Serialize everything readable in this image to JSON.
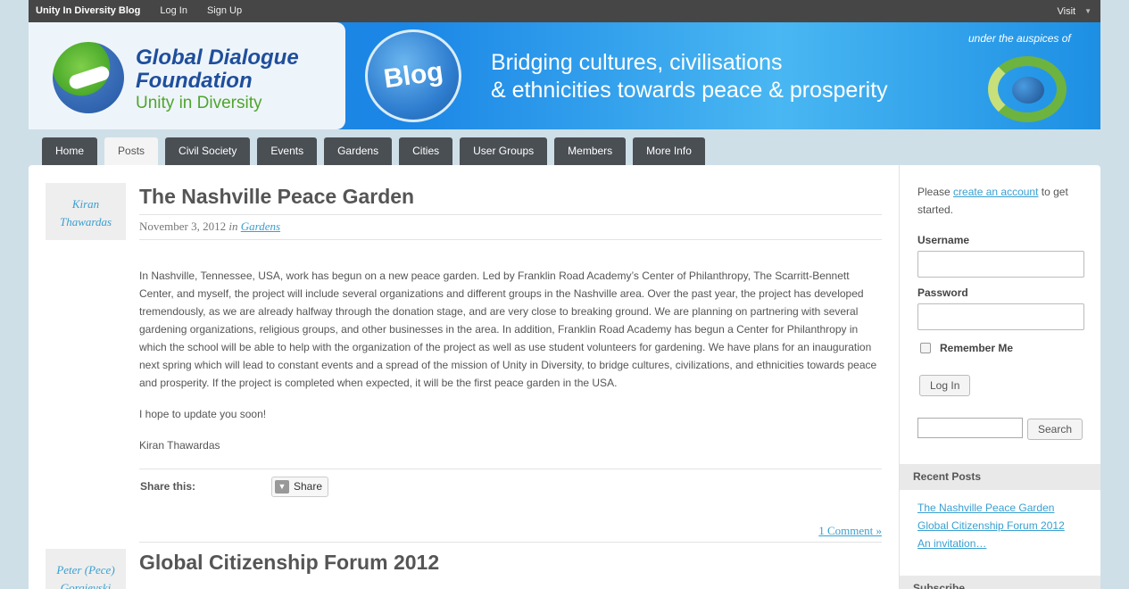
{
  "adminbar": {
    "site_name": "Unity In Diversity Blog",
    "login": "Log In",
    "signup": "Sign Up",
    "visit": "Visit"
  },
  "header": {
    "org_line1": "Global Dialogue",
    "org_line2": "Foundation",
    "org_line3": "Unity in Diversity",
    "badge": "Blog",
    "tagline_line1": "Bridging cultures, civilisations",
    "tagline_line2": "& ethnicities towards peace & prosperity",
    "auspices": "under the auspices of"
  },
  "nav": {
    "tabs": [
      {
        "label": "Home"
      },
      {
        "label": "Posts",
        "active": true
      },
      {
        "label": "Civil Society"
      },
      {
        "label": "Events"
      },
      {
        "label": "Gardens"
      },
      {
        "label": "Cities"
      },
      {
        "label": "User Groups"
      },
      {
        "label": "Members"
      },
      {
        "label": "More Info"
      }
    ]
  },
  "posts": [
    {
      "author_line1": "Kiran",
      "author_line2": "Thawardas",
      "title": "The Nashville Peace Garden",
      "date": "November 3, 2012",
      "in_word": "in",
      "category": "Gardens",
      "paragraphs": [
        "In Nashville, Tennessee, USA, work has begun on a new peace garden. Led by Franklin Road Academy’s Center of Philanthropy, The Scarritt-Bennett Center, and myself, the project will include several organizations and different groups in the Nashville area. Over the past year, the project has developed tremendously, as we are already halfway through the donation stage, and are very close to breaking ground. We are planning on partnering with several gardening organizations, religious groups, and other businesses in the area. In addition, Franklin Road Academy has begun a Center for Philanthropy in which the school will be able to help with the organization of the project as well as use student volunteers for gardening. We have plans for an inauguration next spring which will lead to constant events and a spread of the mission of Unity in Diversity, to bridge cultures, civilizations, and ethnicities towards peace and prosperity. If the project is completed when expected, it will be the first peace garden in the USA.",
        "I hope to update you soon!",
        "Kiran Thawardas"
      ],
      "share_label": "Share this:",
      "share_button": "Share",
      "comments_link": "1 Comment »"
    },
    {
      "author_line1": "Peter (Pece)",
      "author_line2": "Gorgievski",
      "title": "Global Citizenship Forum 2012"
    }
  ],
  "sidebar": {
    "intro_prefix": "Please ",
    "intro_link": "create an account",
    "intro_suffix": " to get started.",
    "username_label": "Username",
    "password_label": "Password",
    "remember_label": "Remember Me",
    "login_button": "Log In",
    "search_button": "Search",
    "recent_heading": "Recent Posts",
    "recent_posts": [
      "The Nashville Peace Garden",
      "Global Citizenship Forum 2012",
      "An invitation…"
    ],
    "subscribe_heading": "Subscribe"
  },
  "colors": {
    "link": "#3a9fd0",
    "nav_tab": "#4a4f54",
    "adminbar": "#464646",
    "page_bg": "#cfdfe8"
  }
}
